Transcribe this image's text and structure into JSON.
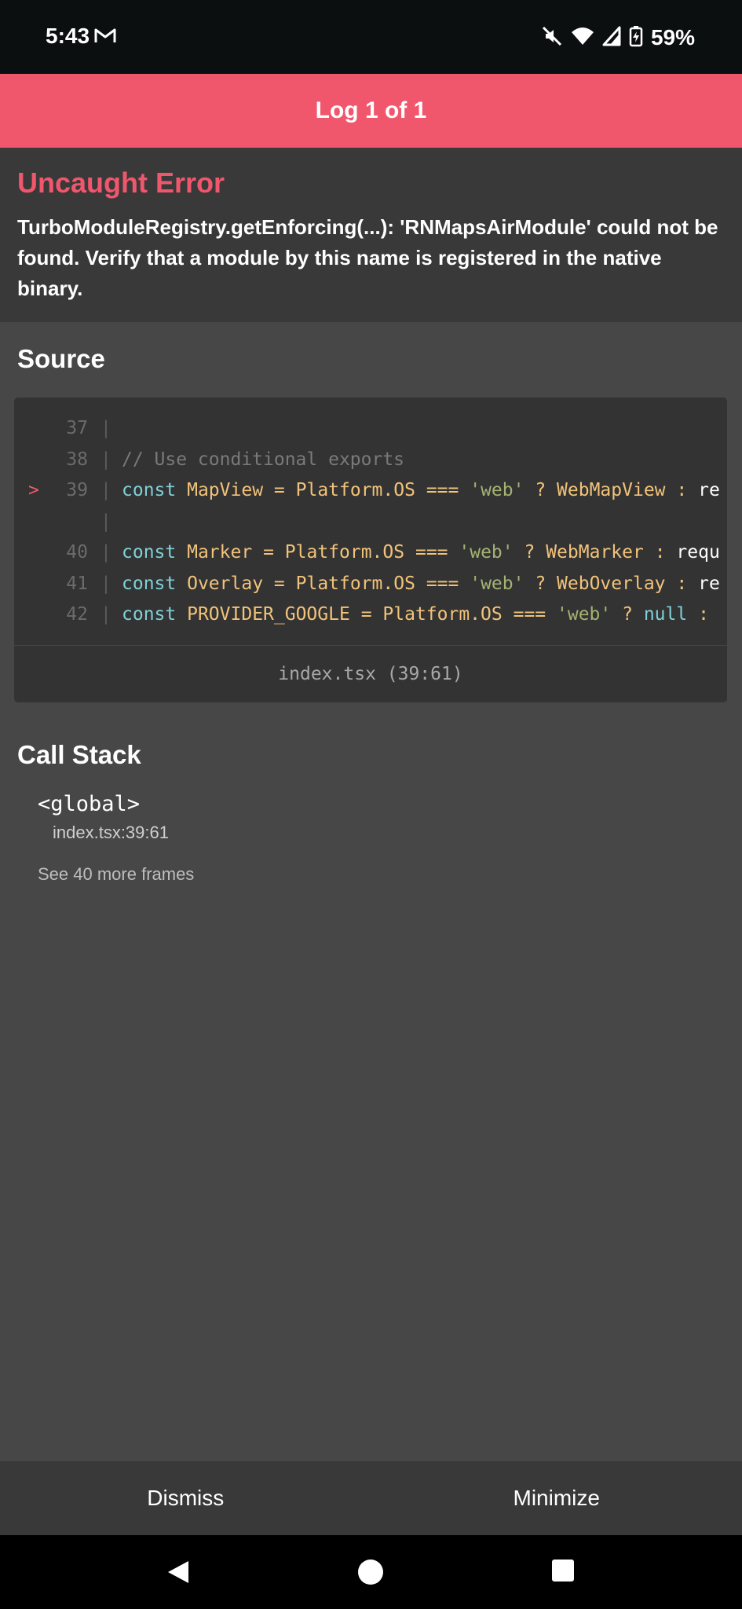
{
  "status_bar": {
    "time": "5:43",
    "battery": "59%",
    "icons": [
      "gmail-icon",
      "mute-icon",
      "wifi-icon",
      "signal-icon",
      "battery-charging-icon"
    ]
  },
  "header": {
    "title": "Log 1 of 1",
    "accent_color": "#f0566c"
  },
  "error": {
    "type": "Uncaught Error",
    "message": "TurboModuleRegistry.getEnforcing(...): 'RNMapsAirModule' could not be found. Verify that a module by this name is registered in the native binary."
  },
  "source": {
    "title": "Source",
    "lines": [
      {
        "number": "37",
        "marker": "",
        "text": ""
      },
      {
        "number": "38",
        "marker": "",
        "text": "// Use conditional exports"
      },
      {
        "number": "39",
        "marker": ">",
        "text": "const MapView = Platform.OS === 'web' ? WebMapView : re"
      },
      {
        "number": "",
        "marker": "",
        "text": ""
      },
      {
        "number": "40",
        "marker": "",
        "text": "const Marker = Platform.OS === 'web' ? WebMarker : requ"
      },
      {
        "number": "41",
        "marker": "",
        "text": "const Overlay = Platform.OS === 'web' ? WebOverlay : re"
      },
      {
        "number": "42",
        "marker": "",
        "text": "const PROVIDER_GOOGLE = Platform.OS === 'web' ? null :"
      }
    ],
    "file_location": "index.tsx (39:61)"
  },
  "call_stack": {
    "title": "Call Stack",
    "frames": [
      {
        "name": "<global>",
        "location": "index.tsx:39:61"
      }
    ],
    "more_frames_label": "See 40 more frames"
  },
  "actions": {
    "dismiss_label": "Dismiss",
    "minimize_label": "Minimize"
  },
  "nav": {
    "icons": [
      "back-icon",
      "home-icon",
      "recents-icon"
    ]
  }
}
